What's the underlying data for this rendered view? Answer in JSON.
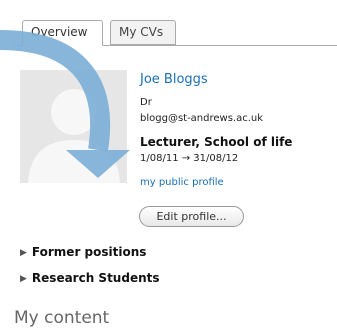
{
  "tabs": [
    {
      "label": "Overview",
      "active": true
    },
    {
      "label": "My CVs",
      "active": false
    }
  ],
  "profile": {
    "name": "Joe Bloggs",
    "title": "Dr",
    "email": "blogg@st-andrews.ac.uk",
    "position": "Lecturer, School of life",
    "dates": "1/08/11 → 31/08/12",
    "public_profile_link": "my public profile",
    "edit_button": "Edit profile..."
  },
  "sections": [
    {
      "label": "Former positions",
      "expanded": false
    },
    {
      "label": "Research Students",
      "expanded": false
    }
  ],
  "my_content_heading": "My content",
  "colors": {
    "link": "#1a6fb5",
    "arrow": "#7aaed6"
  },
  "icons": {
    "avatar": "default-avatar-icon",
    "section_toggle": "triangle-right-icon",
    "annotation": "curved-arrow-icon"
  }
}
